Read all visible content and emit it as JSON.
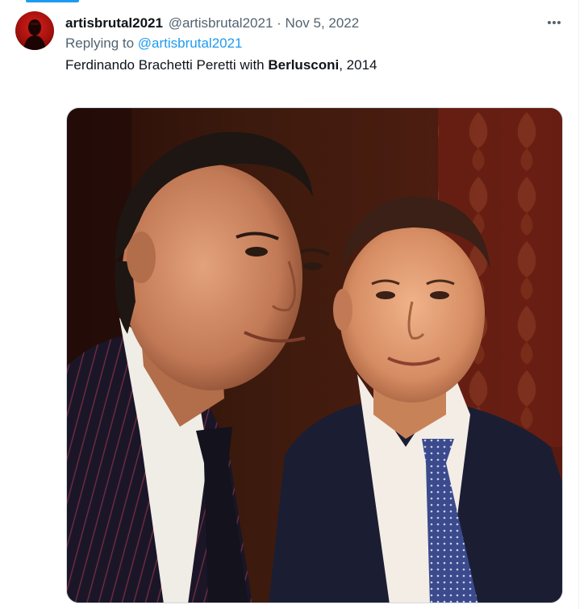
{
  "tweet": {
    "display_name": "artisbrutal2021",
    "handle": "@artisbrutal2021",
    "separator": "·",
    "date": "Nov 5, 2022",
    "reply_prefix": "Replying to",
    "reply_to": "@artisbrutal2021",
    "text_before": "Ferdinando Brachetti Peretti with ",
    "text_bold": "Berlusconi",
    "text_after": ", 2014",
    "more_icon": "more-horizontal-icon",
    "avatar_icon": "profile-avatar"
  },
  "colors": {
    "link": "#1d9bf0",
    "secondary_text": "#536471",
    "primary_text": "#0f1419",
    "border": "#cfd9de"
  }
}
